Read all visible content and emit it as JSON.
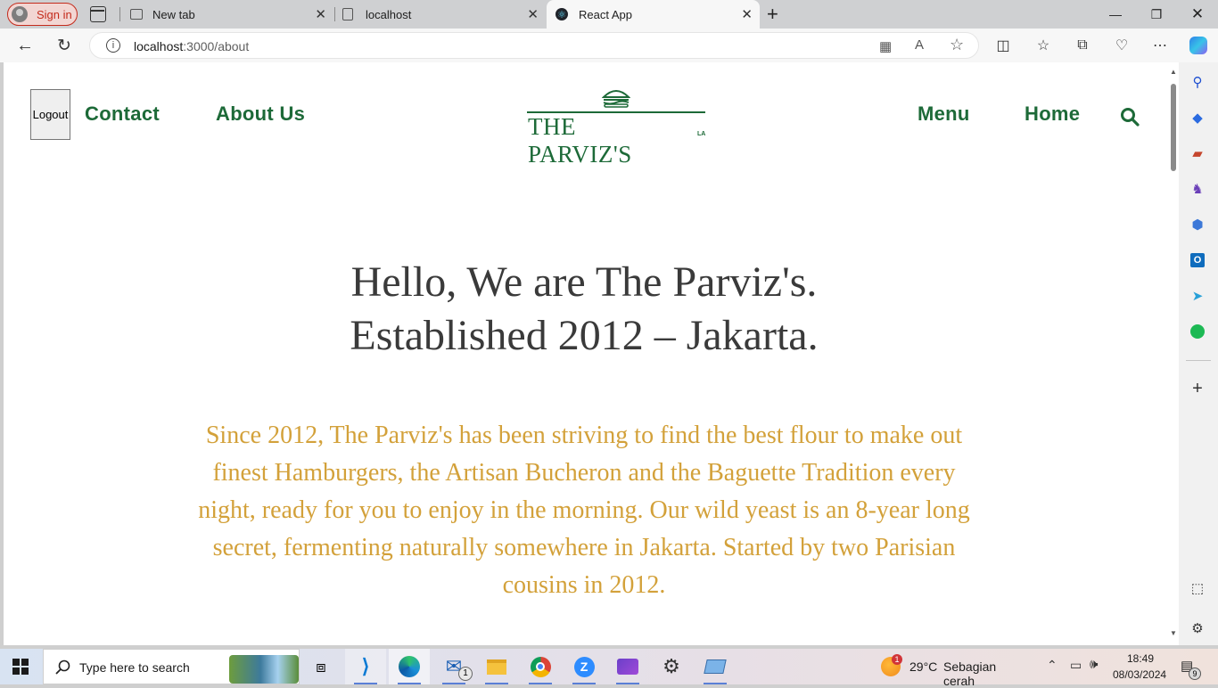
{
  "browser": {
    "signin_label": "Sign in",
    "tabs": [
      {
        "title": "New tab"
      },
      {
        "title": "localhost"
      },
      {
        "title": "React App"
      }
    ],
    "url_host": "localhost",
    "url_path": ":3000/about"
  },
  "site": {
    "logout_label": "Logout",
    "nav_left": [
      "Contact",
      "About Us"
    ],
    "nav_right": [
      "Menu",
      "Home"
    ],
    "logo_text": "THE PARVIZ'S",
    "logo_suffix": "LA",
    "hero_line1": "Hello, We are The Parviz's.",
    "hero_line2": "Established 2012 – Jakarta.",
    "story": "Since 2012, The Parviz's has been striving to find the best flour to make out finest Hamburgers, the Artisan Bucheron and the Baguette Tradition every night, ready for you to enjoy in the morning. Our wild yeast is an 8-year long secret, fermenting naturally somewhere in Jakarta. Started by two Parisian cousins in 2012."
  },
  "colors": {
    "brand_green": "#1d6a38",
    "story_gold": "#d3a13a",
    "hero_text": "#3a3a3a"
  },
  "taskbar": {
    "search_placeholder": "Type here to search",
    "weather_temp": "29°C",
    "weather_desc": "Sebagian cerah",
    "weather_badge": "1",
    "mail_badge": "1",
    "time": "18:49",
    "date": "08/03/2024",
    "notification_count": "9"
  }
}
